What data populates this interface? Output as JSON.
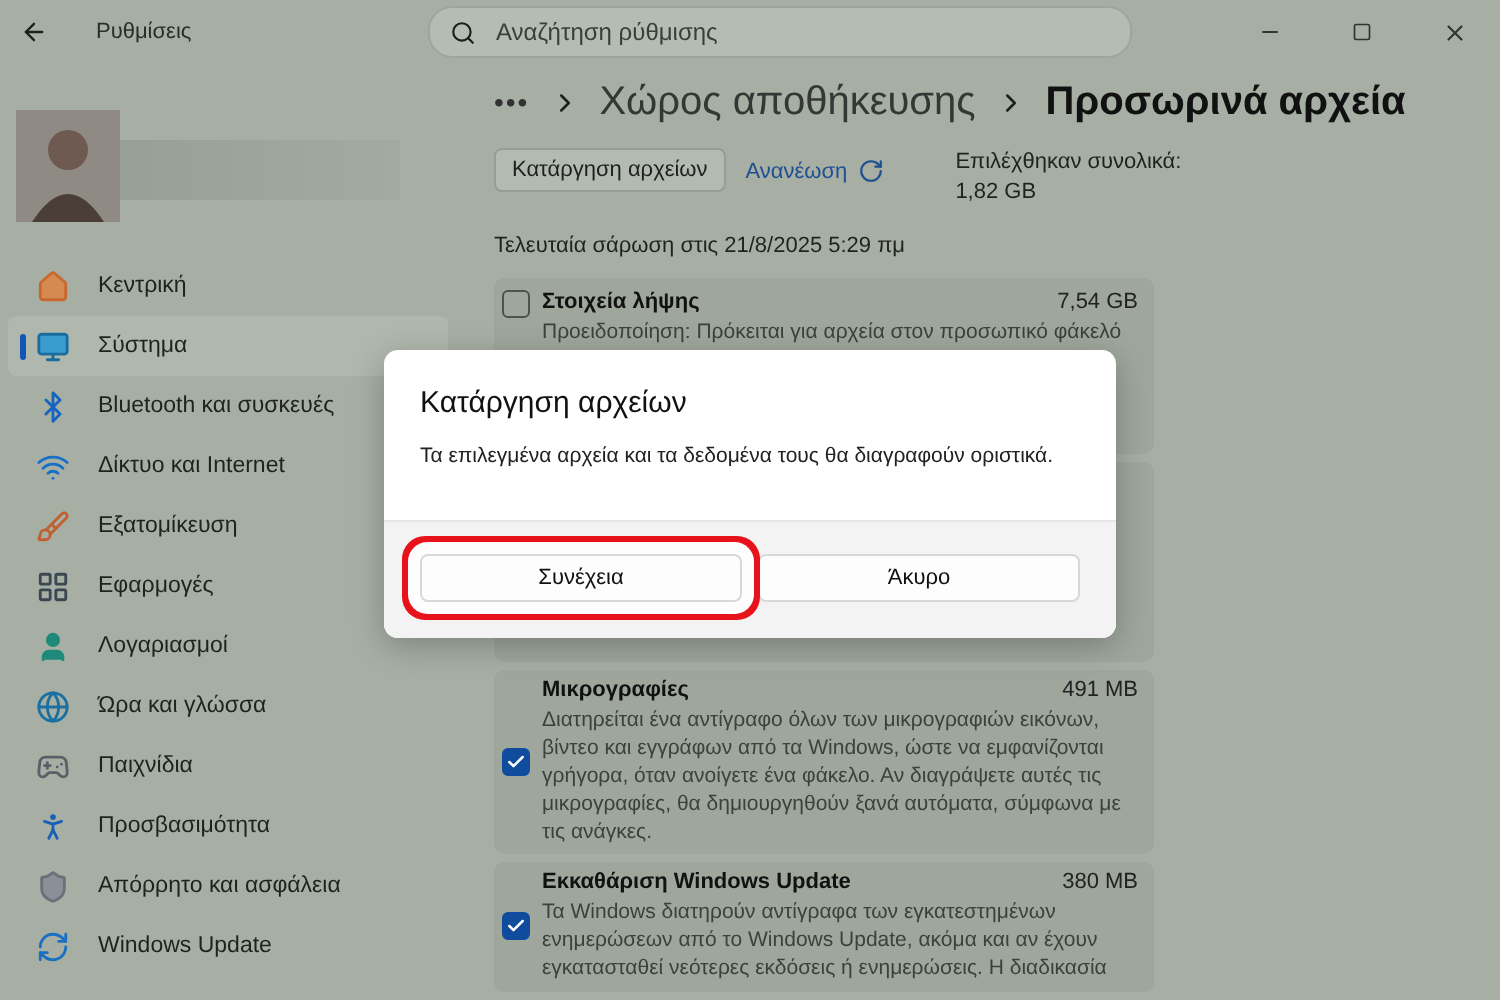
{
  "window": {
    "title": "Ρυθμίσεις"
  },
  "search": {
    "placeholder": "Αναζήτηση ρύθμισης"
  },
  "sidebar": {
    "items": [
      {
        "label": "Κεντρική",
        "selected": false
      },
      {
        "label": "Σύστημα",
        "selected": true
      },
      {
        "label": "Bluetooth και συσκευές",
        "selected": false
      },
      {
        "label": "Δίκτυο και Internet",
        "selected": false
      },
      {
        "label": "Εξατομίκευση",
        "selected": false
      },
      {
        "label": "Εφαρμογές",
        "selected": false
      },
      {
        "label": "Λογαριασμοί",
        "selected": false
      },
      {
        "label": "Ώρα και γλώσσα",
        "selected": false
      },
      {
        "label": "Παιχνίδια",
        "selected": false
      },
      {
        "label": "Προσβασιμότητα",
        "selected": false
      },
      {
        "label": "Απόρρητο και ασφάλεια",
        "selected": false
      },
      {
        "label": "Windows Update",
        "selected": false
      }
    ]
  },
  "breadcrumb": {
    "overflow": "•••",
    "items": [
      "Χώρος αποθήκευσης",
      "Προσωρινά αρχεία"
    ]
  },
  "toolbar": {
    "remove_button": "Κατάργηση αρχείων",
    "refresh_link": "Ανανέωση",
    "total_label": "Επιλέχθηκαν συνολικά:",
    "total_value": "1,82 GB"
  },
  "last_scan": "Τελευταία σάρωση στις 21/8/2025 5:29 πμ",
  "items": [
    {
      "name": "Στοιχεία λήψης",
      "size": "7,54 GB",
      "description": "Προειδοποίηση: Πρόκειται για αρχεία στον προσωπικό φάκελό",
      "checked": false
    },
    {
      "name": "Μικρογραφίες",
      "size": "491 MB",
      "description": "Διατηρείται ένα αντίγραφο όλων των μικρογραφιών εικόνων, βίντεο και εγγράφων από τα Windows, ώστε να εμφανίζονται γρήγορα, όταν ανοίγετε ένα φάκελο. Αν διαγράψετε αυτές τις μικρογραφίες, θα δημιουργηθούν ξανά αυτόματα, σύμφωνα με τις ανάγκες.",
      "checked": true
    },
    {
      "name": "Εκκαθάριση Windows Update",
      "size": "380 MB",
      "description": "Τα Windows διατηρούν αντίγραφα των εγκατεστημένων ενημερώσεων από το Windows Update, ακόμα και αν έχουν εγκατασταθεί νεότερες εκδόσεις ή ενημερώσεις. Η διαδικασία",
      "checked": true
    }
  ],
  "dialog": {
    "title": "Κατάργηση αρχείων",
    "message": "Τα επιλεγμένα αρχεία και τα δεδομένα τους θα διαγραφούν οριστικά.",
    "buttons": [
      {
        "label": "Συνέχεια",
        "highlighted": true
      },
      {
        "label": "Άκυρο",
        "highlighted": false
      }
    ]
  }
}
